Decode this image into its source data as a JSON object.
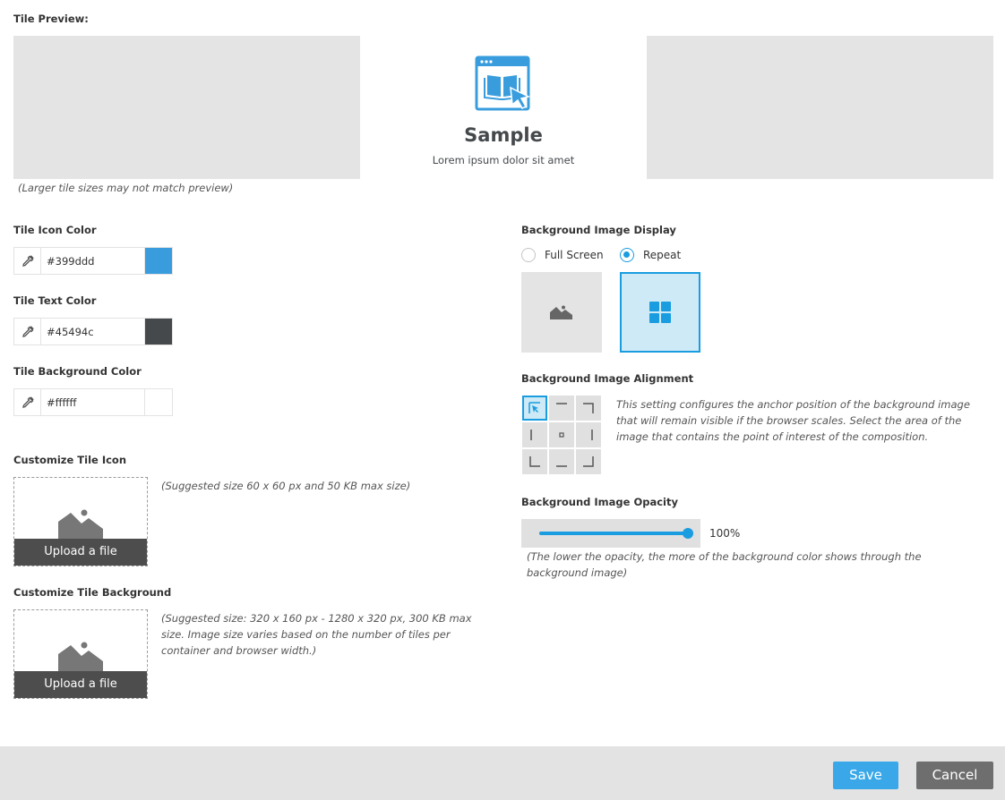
{
  "preview": {
    "label": "Tile Preview:",
    "sample_title": "Sample",
    "sample_subtitle": "Lorem ipsum dolor sit amet",
    "note": "(Larger tile sizes may not match preview)"
  },
  "colors": {
    "icon": {
      "label": "Tile Icon Color",
      "value": "#399ddd",
      "swatch": "#399ddd"
    },
    "text": {
      "label": "Tile Text Color",
      "value": "#45494c",
      "swatch": "#45494c"
    },
    "background": {
      "label": "Tile Background Color",
      "value": "#ffffff",
      "swatch": "#ffffff"
    }
  },
  "icon_upload": {
    "label": "Customize Tile Icon",
    "button": "Upload a file",
    "note": "(Suggested size 60 x 60 px and 50 KB max size)"
  },
  "bg_upload": {
    "label": "Customize Tile Background",
    "button": "Upload a file",
    "note": "(Suggested size: 320 x 160 px - 1280 x 320 px, 300 KB max size. Image size varies based on the number of tiles per container and browser width.)"
  },
  "display": {
    "label": "Background Image Display",
    "options": [
      "Full Screen",
      "Repeat"
    ],
    "selected": "Repeat"
  },
  "alignment": {
    "label": "Background Image Alignment",
    "note": "This setting configures the anchor position of the background image that will remain visible if the browser scales. Select the area of the image that contains the point of interest of the composition.",
    "selected": "top-left"
  },
  "opacity": {
    "label": "Background Image Opacity",
    "value": 100,
    "value_text": "100%",
    "note": "(The lower the opacity, the more of the background color shows through the background image)"
  },
  "footer": {
    "save": "Save",
    "cancel": "Cancel"
  },
  "theme": {
    "accent": "#1a9de0",
    "save_bg": "#3aa8e8",
    "cancel_bg": "#6e6e6e"
  }
}
